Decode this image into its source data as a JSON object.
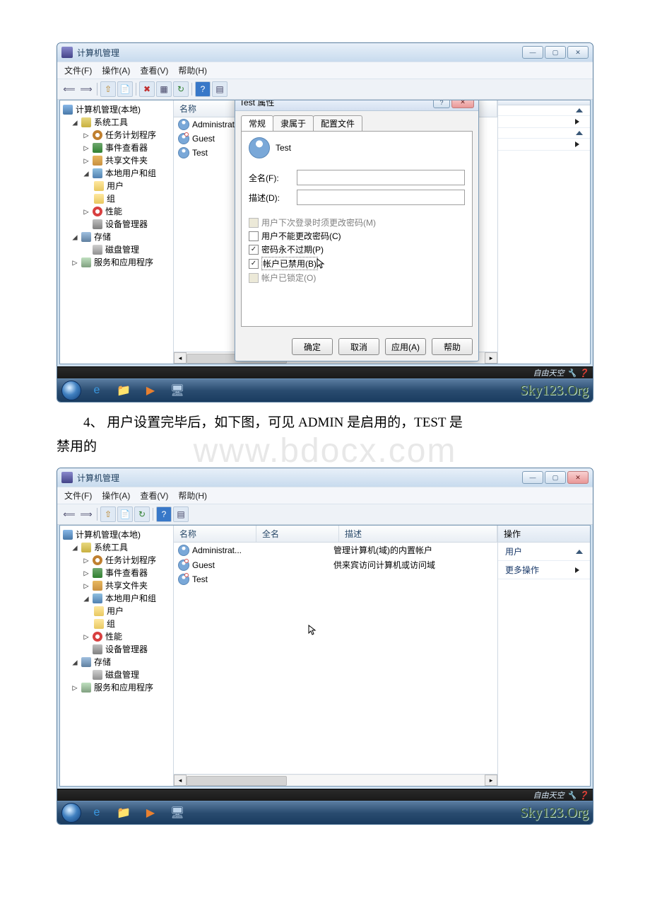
{
  "document": {
    "watermark": "www.bdocx.com",
    "paragraph_prefix": "4、 用户设置完毕后，如下图，可见 ADMIN 是启用的，TEST 是",
    "paragraph_line2": "禁用的"
  },
  "window": {
    "title": "计算机管理",
    "menus": [
      "文件(F)",
      "操作(A)",
      "查看(V)",
      "帮助(H)"
    ],
    "actions_header": "操作",
    "action_items": [
      "用户",
      "更多操作"
    ],
    "tree": {
      "root": "计算机管理(本地)",
      "sys_tools": "系统工具",
      "task": "任务计划程序",
      "evt": "事件查看器",
      "share": "共享文件夹",
      "local_users": "本地用户和组",
      "users": "用户",
      "groups": "组",
      "perf": "性能",
      "devmgr": "设备管理器",
      "storage": "存储",
      "disk": "磁盘管理",
      "svc": "服务和应用程序"
    },
    "list": {
      "cols": {
        "name": "名称",
        "fullname": "全名",
        "desc": "描述"
      },
      "col_name_only": "名称",
      "rows": [
        {
          "name": "Administrat...",
          "desc": "管理计算机(域)的内置帐户"
        },
        {
          "name": "Guest",
          "desc": "供来宾访问计算机或访问域"
        },
        {
          "name": "Test",
          "desc": ""
        }
      ]
    }
  },
  "dialog": {
    "title": "Test 属性",
    "tabs": [
      "常规",
      "隶属于",
      "配置文件"
    ],
    "username": "Test",
    "fullname_label": "全名(F):",
    "desc_label": "描述(D):",
    "chk_next_login": "用户下次登录时须更改密码(M)",
    "chk_cant_change": "用户不能更改密码(C)",
    "chk_never_expire": "密码永不过期(P)",
    "chk_disabled": "帐户已禁用(B)",
    "chk_locked": "帐户已锁定(O)",
    "buttons": {
      "ok": "确定",
      "cancel": "取消",
      "apply": "应用(A)",
      "help": "帮助"
    }
  },
  "brand": {
    "tag": "自由天空",
    "sky": "Sky123.Org"
  }
}
